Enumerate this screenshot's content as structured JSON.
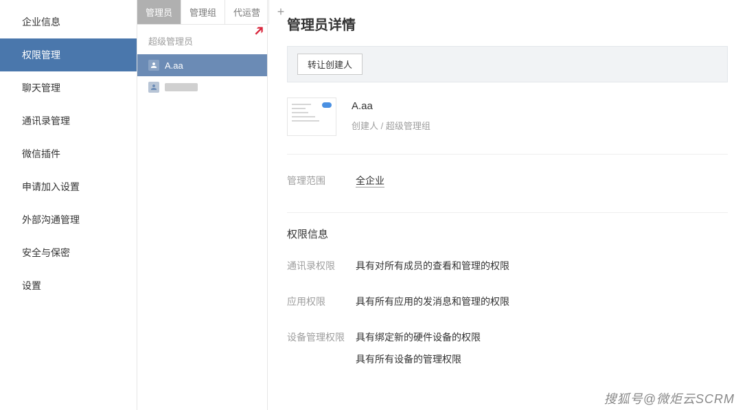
{
  "sidebar": {
    "items": [
      {
        "label": "企业信息"
      },
      {
        "label": "权限管理"
      },
      {
        "label": "聊天管理"
      },
      {
        "label": "通讯录管理"
      },
      {
        "label": "微信插件"
      },
      {
        "label": "申请加入设置"
      },
      {
        "label": "外部沟通管理"
      },
      {
        "label": "安全与保密"
      },
      {
        "label": "设置"
      }
    ],
    "activeIndex": 1
  },
  "tabs": {
    "items": [
      {
        "label": "管理员"
      },
      {
        "label": "管理组"
      },
      {
        "label": "代运营"
      }
    ],
    "activeIndex": 0,
    "addLabel": "+"
  },
  "adminList": {
    "sectionLabel": "超级管理员",
    "items": [
      {
        "name": "A.aa",
        "redacted": false
      },
      {
        "name": "",
        "redacted": true
      }
    ],
    "selectedIndex": 0
  },
  "detail": {
    "title": "管理员详情",
    "transferBtn": "转让创建人",
    "profile": {
      "name": "A.aa",
      "meta": "创建人 / 超级管理组"
    },
    "scope": {
      "label": "管理范围",
      "value": "全企业"
    },
    "permSection": {
      "title": "权限信息",
      "rows": [
        {
          "label": "通讯录权限",
          "values": [
            "具有对所有成员的查看和管理的权限"
          ]
        },
        {
          "label": "应用权限",
          "values": [
            "具有所有应用的发消息和管理的权限"
          ]
        },
        {
          "label": "设备管理权限",
          "values": [
            "具有绑定新的硬件设备的权限",
            "具有所有设备的管理权限"
          ]
        }
      ]
    }
  },
  "watermark": "搜狐号@微炬云SCRM"
}
